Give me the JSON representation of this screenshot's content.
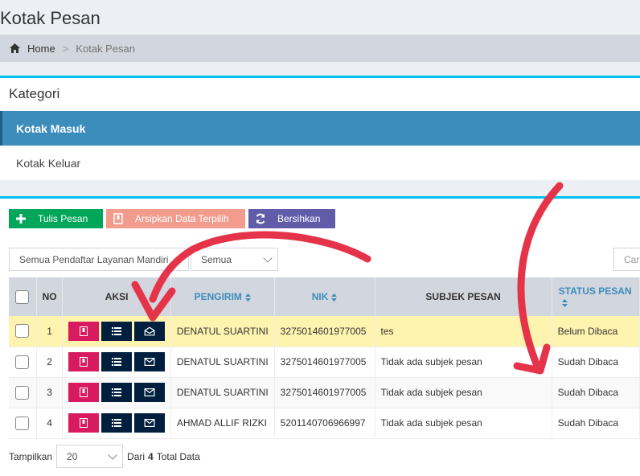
{
  "page": {
    "title": "Kotak Pesan"
  },
  "breadcrumb": {
    "home": "Home",
    "separator": ">",
    "current": "Kotak Pesan"
  },
  "kategori": {
    "title": "Kategori",
    "items": [
      {
        "label": "Kotak Masuk",
        "active": true
      },
      {
        "label": "Kotak Keluar",
        "active": false
      }
    ]
  },
  "toolbar": {
    "write_label": "Tulis Pesan",
    "archive_label": "Arsipkan Data Terpilih",
    "clear_label": "Bersihkan"
  },
  "filters": {
    "pendaftar": "Semua Pendaftar Layanan Mandiri",
    "status": "Semua",
    "search_placeholder": "Cari"
  },
  "table": {
    "headers": [
      "NO",
      "AKSI",
      "PENGIRIM",
      "NIK",
      "SUBJEK PESAN",
      "STATUS PESAN"
    ],
    "rows": [
      {
        "no": "1",
        "pengirim": "DENATUL SUARTINI",
        "nik": "3275014601977005",
        "subjek": "tes",
        "status": "Belum Dibaca",
        "unread": true
      },
      {
        "no": "2",
        "pengirim": "DENATUL SUARTINI",
        "nik": "3275014601977005",
        "subjek": "Tidak ada subjek pesan",
        "status": "Sudah Dibaca",
        "unread": false
      },
      {
        "no": "3",
        "pengirim": "DENATUL SUARTINI",
        "nik": "3275014601977005",
        "subjek": "Tidak ada subjek pesan",
        "status": "Sudah Dibaca",
        "unread": false
      },
      {
        "no": "4",
        "pengirim": "AHMAD ALLIF RIZKI",
        "nik": "5201140706966997",
        "subjek": "Tidak ada subjek pesan",
        "status": "Sudah Dibaca",
        "unread": false
      }
    ]
  },
  "footer": {
    "show_label": "Tampilkan",
    "page_size": "20",
    "of_label": "Dari",
    "total": "4",
    "total_label": "Total Data"
  },
  "colors": {
    "accent": "#3c8dbc",
    "box_border": "#00c0ef",
    "unread_row": "#fff3b0",
    "annotation_arrow": "#e5344a"
  }
}
